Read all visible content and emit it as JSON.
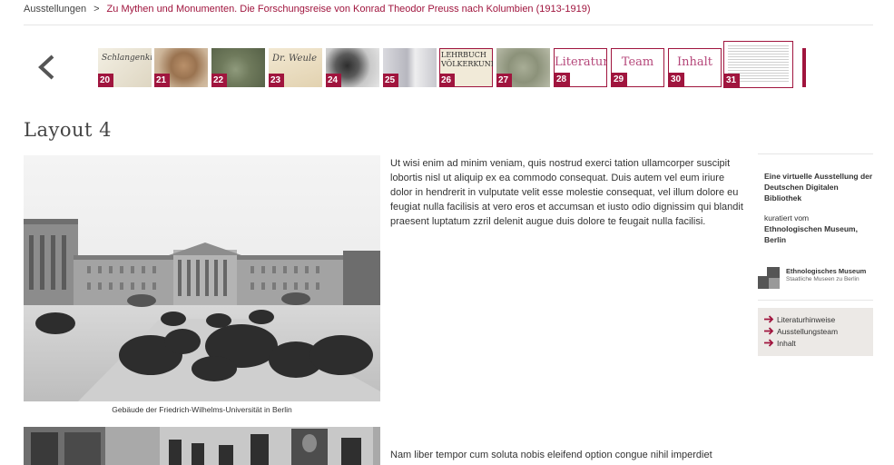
{
  "breadcrumb": {
    "root": "Ausstellungen",
    "separator": ">",
    "current": "Zu Mythen und Monumenten. Die Forschungsreise von Konrad Theodor Preuss nach Kolumbien (1913-1919)"
  },
  "navigation": {
    "prev_icon": "chevron-left-icon"
  },
  "thumbnails": [
    {
      "num": "20",
      "kind": "image",
      "caption_glyph": "Schlangenkin"
    },
    {
      "num": "21",
      "kind": "image"
    },
    {
      "num": "22",
      "kind": "image"
    },
    {
      "num": "23",
      "kind": "image",
      "caption_glyph": "Dr. Weule"
    },
    {
      "num": "24",
      "kind": "image"
    },
    {
      "num": "25",
      "kind": "image"
    },
    {
      "num": "26",
      "kind": "image",
      "caption_glyph": "LEHRBUCH VÖLKERKUNDE"
    },
    {
      "num": "27",
      "kind": "image"
    },
    {
      "num": "28",
      "kind": "text",
      "title": "Literatur"
    },
    {
      "num": "29",
      "kind": "text",
      "title": "Team"
    },
    {
      "num": "30",
      "kind": "text",
      "title": "Inhalt"
    },
    {
      "num": "31",
      "kind": "page",
      "active": true
    }
  ],
  "page": {
    "title": "Layout 4",
    "caption1": "Gebäude der Friedrich-Wilhelms-Universität in Berlin",
    "paragraph1": "Ut wisi enim ad minim veniam, quis nostrud exerci tation ullamcorper suscipit lobortis nisl ut aliquip ex ea commodo consequat. Duis autem vel eum iriure dolor in hendrerit in vulputate velit esse molestie consequat, vel illum dolore eu feugiat nulla facilisis at vero eros et accumsan et iusto odio dignissim qui blandit praesent luptatum zzril delenit augue duis dolore te feugait nulla facilisi.",
    "paragraph2": "Nam liber tempor cum soluta nobis eleifend option congue nihil imperdiet"
  },
  "sidebar": {
    "title": "Eine virtuelle Ausstellung der Deutschen Digitalen Bibliothek",
    "curated_by": "kuratiert vom",
    "curator": "Ethnologischen Museum, Berlin",
    "logo_line1": "Ethnologisches Museum",
    "logo_line2": "Staatliche Museen zu Berlin",
    "links": [
      "Literaturhinweise",
      "Ausstellungsteam",
      "Inhalt"
    ]
  },
  "colors": {
    "accent": "#a0153e",
    "text": "#333333",
    "sidebar_box": "#ece9e6"
  }
}
